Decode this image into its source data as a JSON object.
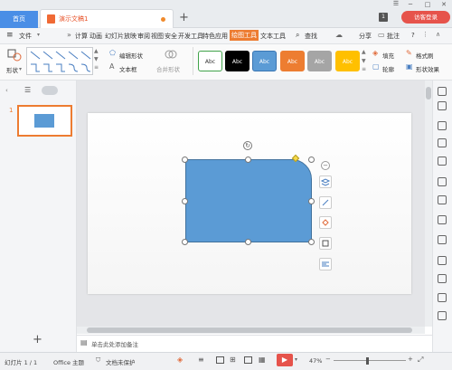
{
  "titlebar": {
    "home_tab": "首页",
    "doc_tab": "演示文稿1",
    "new_tab": "+",
    "window_count": "1",
    "login_button": "访客登录"
  },
  "menubar": {
    "file_menu": "文件",
    "items": [
      "计算",
      "动画",
      "幻灯片放映",
      "审阅",
      "视图",
      "安全",
      "开发工具",
      "特色应用",
      "绘图工具",
      "文本工具"
    ],
    "active_item": "绘图工具",
    "search": "查找",
    "share": "分享",
    "annotate": "批注",
    "help": "?"
  },
  "ribbon": {
    "shape_label": "形状",
    "edit_shape": "编辑形状",
    "text_box": "文本框",
    "merge_shape": "合并形状",
    "styles": [
      {
        "label": "Abc",
        "bg": "#ffffff",
        "fg": "#333333",
        "border": "#41a34a"
      },
      {
        "label": "Abc",
        "bg": "#000000",
        "fg": "#ffffff",
        "border": "#000000"
      },
      {
        "label": "Abc",
        "bg": "#5b9bd5",
        "fg": "#ffffff",
        "border": "#3a76b3"
      },
      {
        "label": "Abc",
        "bg": "#ed7d31",
        "fg": "#ffffff",
        "border": "#ed7d31"
      },
      {
        "label": "Abc",
        "bg": "#a5a5a5",
        "fg": "#ffffff",
        "border": "#a5a5a5"
      },
      {
        "label": "Abc",
        "bg": "#ffc000",
        "fg": "#ffffff",
        "border": "#ffc000"
      }
    ],
    "fill": "填充",
    "format_painter": "格式刷",
    "outline": "轮廓",
    "shape_effect": "形状效果"
  },
  "slides_panel": {
    "slide_number": "1",
    "add_slide": "+"
  },
  "notes": {
    "placeholder": "单击此处添加备注"
  },
  "statusbar": {
    "slide_info": "幻灯片 1 / 1",
    "theme": "Office 主题",
    "protect": "文档未保护",
    "zoom": "47%",
    "zoom_minus": "−",
    "zoom_plus": "+"
  },
  "colors": {
    "accent_orange": "#ed7c31",
    "shape_fill": "#5b9bd5",
    "home_tab_blue": "#4a8ee6",
    "login_red": "#e6534b",
    "play_red": "#e6534b"
  }
}
